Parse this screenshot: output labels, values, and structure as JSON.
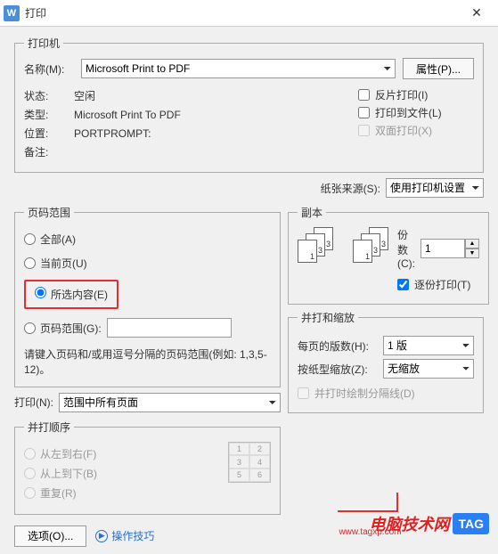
{
  "titlebar": {
    "title": "打印"
  },
  "printer": {
    "legend": "打印机",
    "name_label": "名称(M):",
    "name_value": "Microsoft Print to PDF",
    "properties_btn": "属性(P)...",
    "status_label": "状态:",
    "status_value": "空闲",
    "type_label": "类型:",
    "type_value": "Microsoft Print To PDF",
    "where_label": "位置:",
    "where_value": "PORTPROMPT:",
    "comment_label": "备注:",
    "reverse_print": "反片打印(I)",
    "print_to_file": "打印到文件(L)",
    "duplex": "双面打印(X)"
  },
  "paper_source": {
    "label": "纸张来源(S):",
    "value": "使用打印机设置"
  },
  "page_range": {
    "legend": "页码范围",
    "all": "全部(A)",
    "current": "当前页(U)",
    "selection": "所选内容(E)",
    "pages": "页码范围(G):",
    "hint": "请键入页码和/或用逗号分隔的页码范围(例如: 1,3,5-12)。"
  },
  "print_what": {
    "label": "打印(N):",
    "value": "范围中所有页面"
  },
  "copies": {
    "legend": "副本",
    "label": "份数(C):",
    "value": "1",
    "collate": "逐份打印(T)",
    "stack1": [
      "1",
      "1",
      "1"
    ],
    "stack2": [
      "3",
      "3",
      "3"
    ]
  },
  "order": {
    "legend": "并打顺序",
    "ltr": "从左到右(F)",
    "ttb": "从上到下(B)",
    "repeat": "重复(R)",
    "cells": [
      "1",
      "2",
      "3",
      "4",
      "5",
      "6"
    ]
  },
  "scale": {
    "legend": "并打和缩放",
    "pages_per_sheet_label": "每页的版数(H):",
    "pages_per_sheet_value": "1 版",
    "scale_label": "按纸型缩放(Z):",
    "scale_value": "无缩放",
    "separator": "并打时绘制分隔线(D)"
  },
  "bottom": {
    "options": "选项(O)...",
    "tips": "操作技巧"
  },
  "watermark": {
    "brand": "电脑技术网",
    "url": "www.tagxp.com",
    "tag": "TAG"
  }
}
